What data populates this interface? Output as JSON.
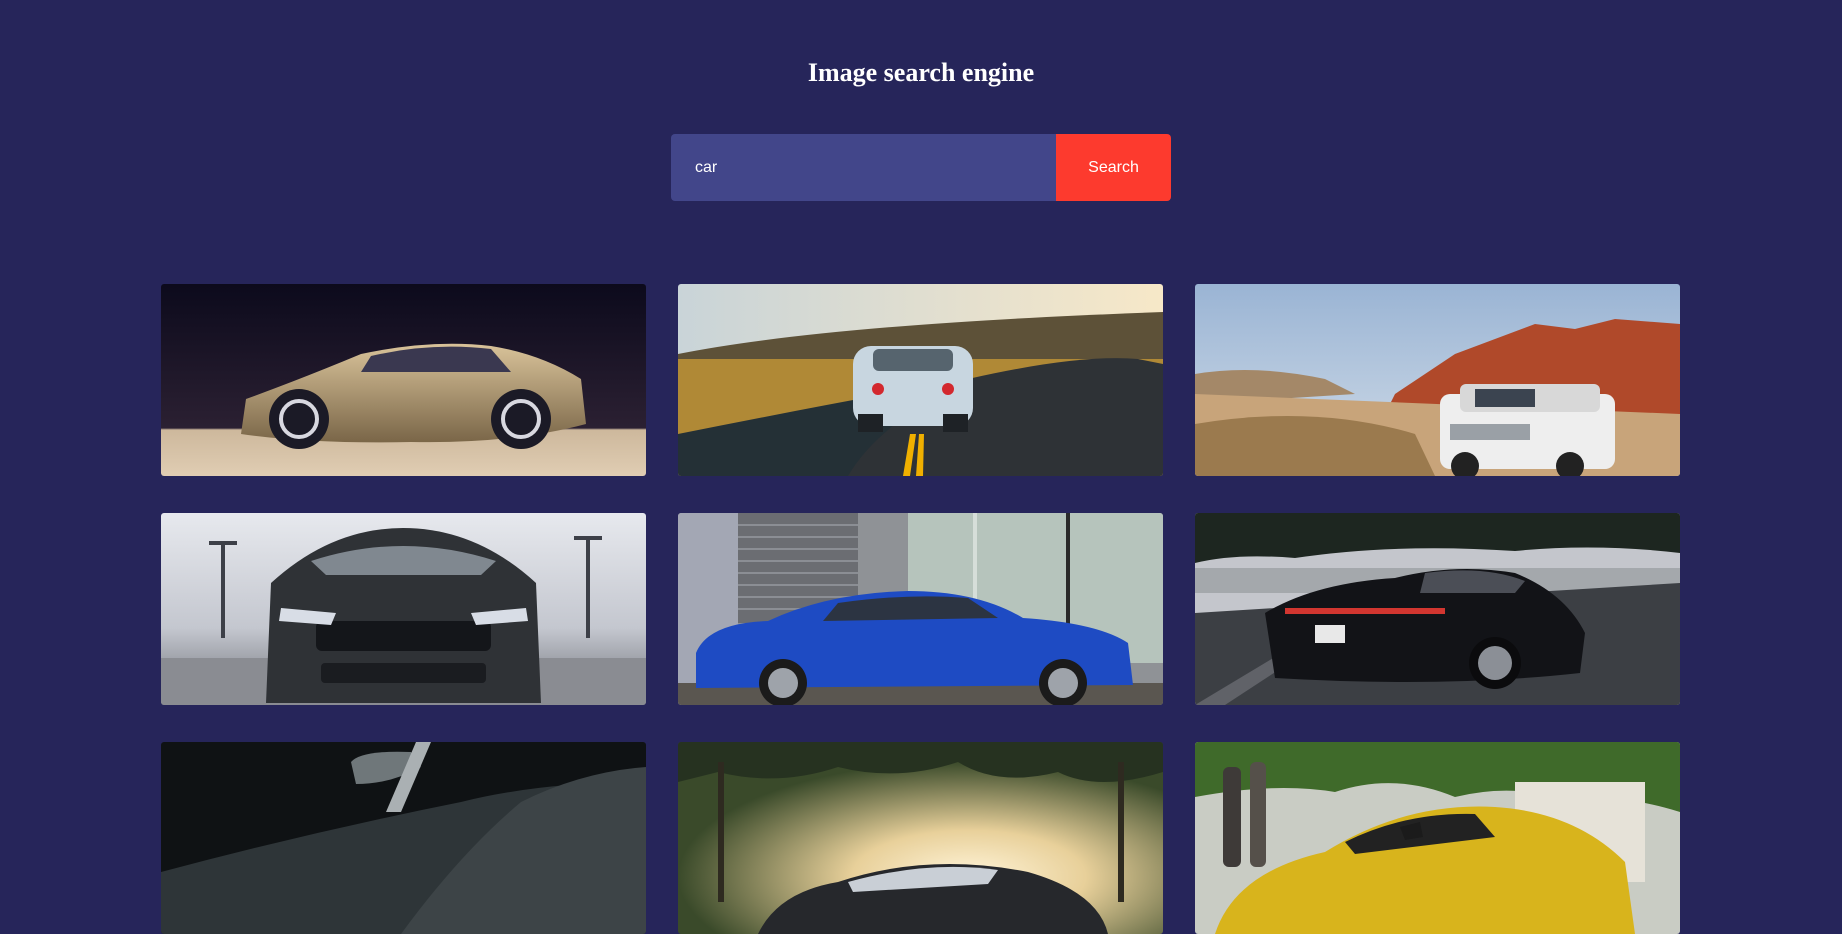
{
  "header": {
    "title": "Image search engine"
  },
  "search": {
    "value": "car",
    "button_label": "Search"
  },
  "colors": {
    "background": "#26255a",
    "input_bg": "#42468a",
    "button_bg": "#fd3a2e",
    "text": "#ffffff"
  },
  "results": [
    {
      "subject": "gold-concept-car"
    },
    {
      "subject": "silver-sports-car-on-road"
    },
    {
      "subject": "white-suv-in-desert"
    },
    {
      "subject": "black-muscle-car-front"
    },
    {
      "subject": "blue-coupe-side"
    },
    {
      "subject": "black-sedan-rear"
    },
    {
      "subject": "dark-car-closeup"
    },
    {
      "subject": "car-under-trees-sunset"
    },
    {
      "subject": "yellow-supercar"
    }
  ]
}
